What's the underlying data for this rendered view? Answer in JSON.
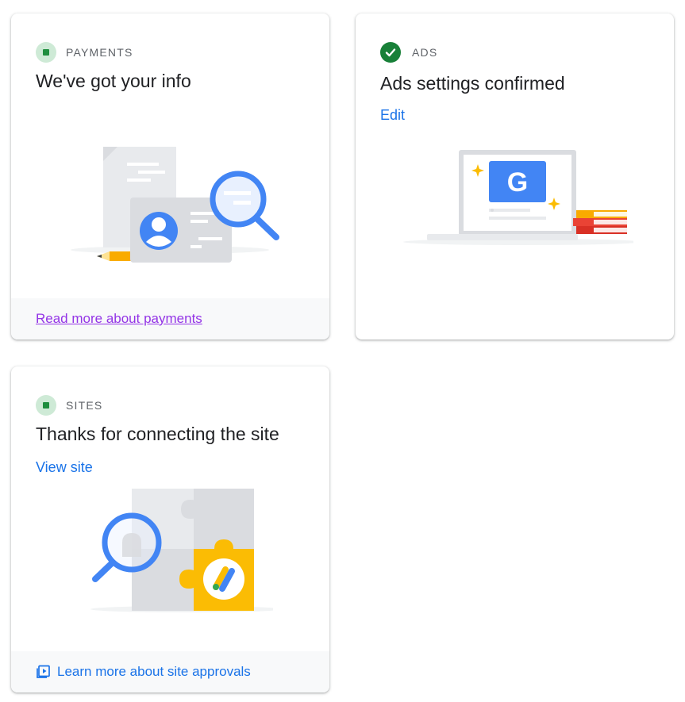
{
  "cards": {
    "payments": {
      "status": "PAYMENTS",
      "title": "We've got your info",
      "footer_link": "Read more about payments"
    },
    "ads": {
      "status": "ADS",
      "title": "Ads settings confirmed",
      "link": "Edit",
      "logo_letter": "G"
    },
    "sites": {
      "status": "SITES",
      "title": "Thanks for connecting the site",
      "link": "View site",
      "footer_link": "Learn more about site approvals"
    }
  },
  "colors": {
    "accent_blue": "#1a73e8",
    "visited_purple": "#9334e6",
    "status_green": "#1e8e3e",
    "status_green_bg": "#ceead6",
    "check_green": "#188038"
  },
  "icons": {
    "payments_status": "status-dot-icon",
    "ads_status": "check-circle-icon",
    "sites_status": "status-dot-icon",
    "sites_footer": "video-icon"
  }
}
